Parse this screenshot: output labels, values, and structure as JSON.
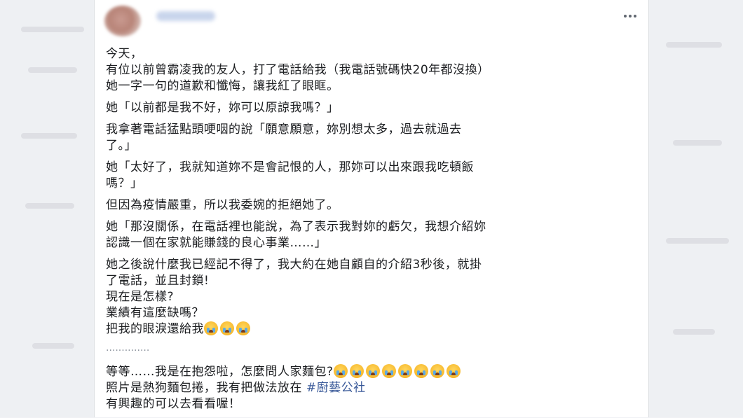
{
  "post": {
    "menu_icon": "more-horizontal-icon",
    "paragraphs": [
      [
        "今天，",
        "有位以前曾霸凌我的友人，打了電話給我（我電話號碼快20年都沒換）",
        "她一字一句的道歉和懺悔，讓我紅了眼眶。"
      ],
      [
        "她「以前都是我不好，妳可以原諒我嗎？」"
      ],
      [
        "我拿著電話猛點頭哽咽的說「願意願意，妳別想太多，過去就過去",
        "了。」"
      ],
      [
        "她「太好了，我就知道妳不是會記恨的人，那妳可以出來跟我吃頓飯",
        "嗎？」"
      ],
      [
        "但因為疫情嚴重，所以我委婉的拒絕她了。"
      ],
      [
        "她「那沒關係，在電話裡也能說，為了表示我對妳的虧欠，我想介紹妳",
        "認識一個在家就能賺錢的良心事業……」"
      ],
      [
        "她之後說什麼我已經記不得了，我大約在她自顧自的介紹3秒後，就掛",
        "了電話，並且封鎖!",
        "現在是怎樣?",
        "業績有這麼缺嗎？"
      ]
    ],
    "tears_line": "把我的眼淚還給我",
    "tears_emoji": "crying-face-emoji",
    "separator": "··············",
    "closing": {
      "line1": "等等……我是在抱怨啦，怎麼問人家麵包?",
      "line2_prefix": "照片是熱狗麵包捲，我有把做法放在",
      "hashtag": "#廚藝公社",
      "line3": "有興趣的可以去看看喔！"
    }
  }
}
